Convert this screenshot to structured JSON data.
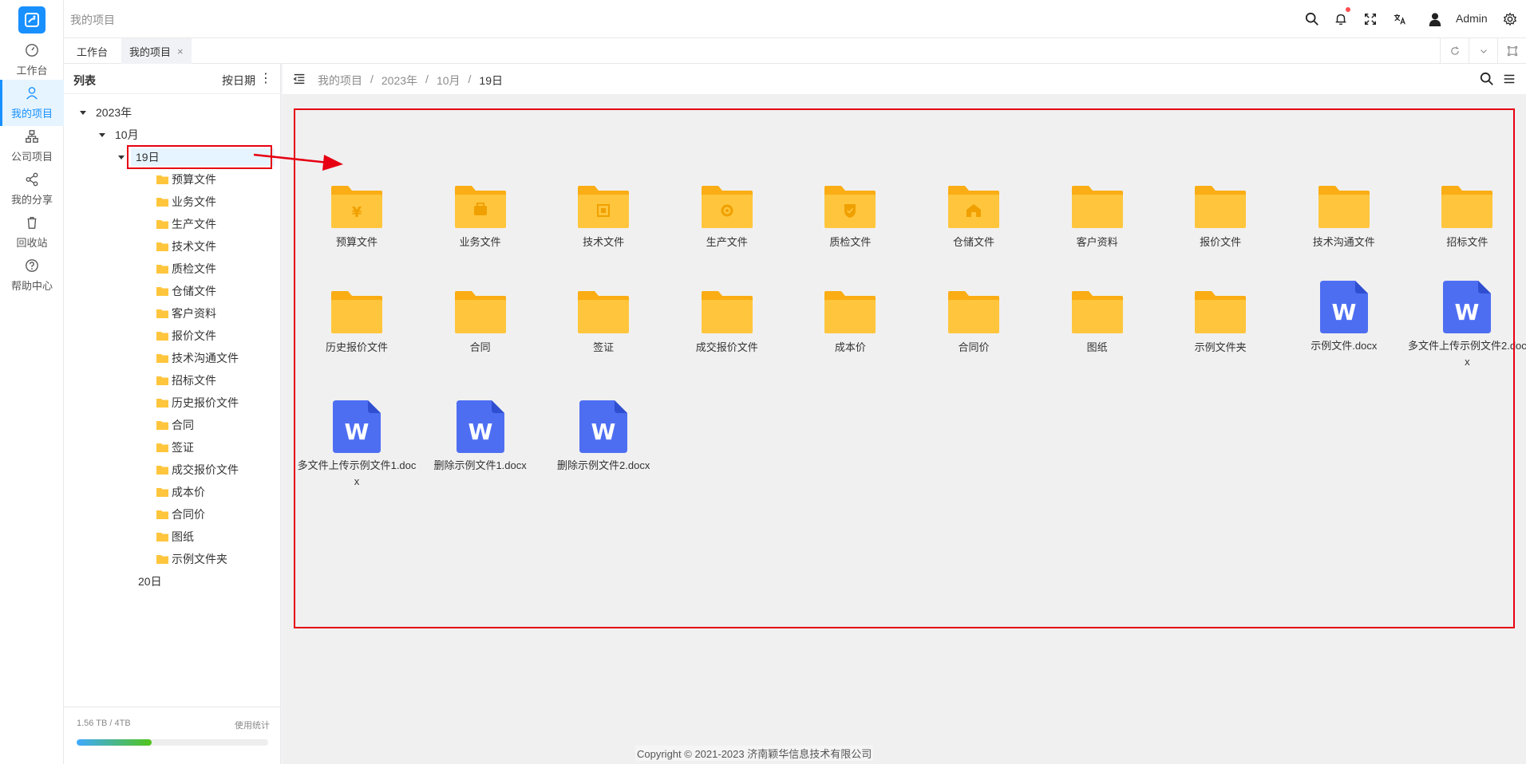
{
  "header": {
    "page_title": "我的项目",
    "user_name": "Admin"
  },
  "leftnav": {
    "items": [
      {
        "label": "工作台",
        "icon": "dashboard-icon"
      },
      {
        "label": "我的项目",
        "icon": "user-icon",
        "active": true
      },
      {
        "label": "公司项目",
        "icon": "org-icon"
      },
      {
        "label": "我的分享",
        "icon": "share-icon"
      },
      {
        "label": "回收站",
        "icon": "trash-icon"
      },
      {
        "label": "帮助中心",
        "icon": "help-icon"
      }
    ]
  },
  "tabs": [
    {
      "label": "工作台"
    },
    {
      "label": "我的项目",
      "close": "×"
    }
  ],
  "tree": {
    "title": "列表",
    "sort_label": "按日期",
    "more": "⋮",
    "year": "2023年",
    "month": "10月",
    "day_selected": "19日",
    "day_other": "20日",
    "folders": [
      "预算文件",
      "业务文件",
      "生产文件",
      "技术文件",
      "质检文件",
      "仓储文件",
      "客户资料",
      "报价文件",
      "技术沟通文件",
      "招标文件",
      "历史报价文件",
      "合同",
      "签证",
      "成交报价文件",
      "成本价",
      "合同价",
      "图纸",
      "示例文件夹"
    ],
    "usage": "1.56 TB / 4TB",
    "usage_fraction": 0.39,
    "stats_label": "使用统计"
  },
  "breadcrumb": [
    "我的项目",
    "2023年",
    "10月",
    "19日"
  ],
  "breadcrumb_sep": "/",
  "grid": {
    "row1": [
      "预算文件",
      "业务文件",
      "技术文件",
      "生产文件",
      "质检文件",
      "仓储文件",
      "客户资料",
      "报价文件",
      "技术沟通文件",
      "招标文件"
    ],
    "row2_folders": [
      "历史报价文件",
      "合同",
      "签证",
      "成交报价文件",
      "成本价",
      "合同价",
      "图纸",
      "示例文件夹"
    ],
    "row2_files": [
      "示例文件.docx",
      "多文件上传示例文件2.docx"
    ],
    "row3_files": [
      "多文件上传示例文件1.docx",
      "删除示例文件1.docx",
      "删除示例文件2.docx"
    ],
    "word_letter": "W"
  },
  "colors": {
    "accent": "#1890ff",
    "folder": "#ffc53d",
    "folder_tab": "#faad14",
    "word": "#4e6ef2",
    "highlight": "#e60012"
  },
  "footer": {
    "copyright": "Copyright © 2021-2023 济南颖华信息技术有限公司"
  }
}
